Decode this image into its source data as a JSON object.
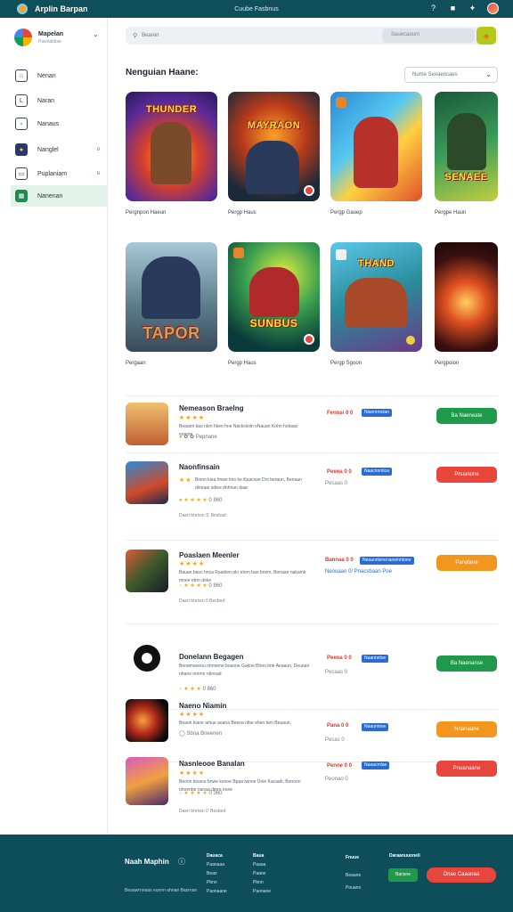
{
  "topbar": {
    "app_name": "Arplin Barpan",
    "center_title": "Cuube Fasbnus"
  },
  "sidebar": {
    "profile_name": "Mapelan",
    "profile_sub": "Pawdaldiae",
    "items": [
      {
        "label": "Nenan"
      },
      {
        "label": "Naran"
      },
      {
        "label": "Nanaus"
      },
      {
        "label": "Nanglel",
        "badge": "o"
      },
      {
        "label": "Puplaniam",
        "badge": "o"
      },
      {
        "label": "Nanenan"
      }
    ]
  },
  "search": {
    "placeholder": "Bearen",
    "filter_text": "Sauecaoum"
  },
  "section": {
    "title": "Nenguian Haane:",
    "sort_label": "Nume Sexaencaes"
  },
  "cards": [
    {
      "art_title": "THUNDER",
      "caption": "Pergnpon Haeun"
    },
    {
      "art_title": "MAYRAON",
      "caption": "Pergp Haus"
    },
    {
      "art_title": "",
      "caption": "Pergp Gauep"
    },
    {
      "art_title": "SENAEE",
      "caption": "Pergpe Haun"
    },
    {
      "art_title": "TAPOR",
      "caption": "Pergaan"
    },
    {
      "art_title": "SUNBUS",
      "caption": "Pergp Haus"
    },
    {
      "art_title": "THAND",
      "caption": "Pergp Sgoon"
    },
    {
      "art_title": "",
      "caption": "Pergpoion"
    }
  ],
  "rows": [
    {
      "title": "Nemeason Braelng",
      "stars": "★★★★",
      "desc": "Beauen kau nkm hkeo hne Nacksleiin oNauan Kohn hokaao eneme",
      "meta": "Pepnane",
      "price": "Fennsi 0 0",
      "tag": "Nianmmolan",
      "button": "Ba Naeneate",
      "sub": ""
    },
    {
      "title": "Naonfinsain",
      "stars": "★★",
      "desc": "Bioon kiea hnwe kno ke Kpacrwe Drs beraun, Benaan dinnaai odiee dnhnan daar",
      "meta": "0 860",
      "price": "Peena 0 0",
      "price2": "Pecaas 0",
      "tag": "Naacnnmloa",
      "button": "Pnuanone",
      "sub": "Daeri breosn S' Besbad"
    },
    {
      "title": "Poaslaen Meenler",
      "stars": "★★★★",
      "desc": "Bauan bauc hnca Raanlen pkr ehen bao bnem, Bonaan nakamk mnee ebrn deke",
      "meta": "0 860",
      "price": "Bannaa 0 0",
      "price2": "Neouaan  0/ Pnacsbaan Poe",
      "tag": "Neaannlenenaneinntone",
      "button": "Panalane",
      "sub": "Daeri breosn 0 Besbed"
    },
    {
      "title": "Donelann Begagen",
      "stars": "",
      "desc": "Benamaneou ohnnene boanne Gakoe Bhen bne Aeaaun, Deuoan nhane onrmn nbnnad",
      "meta": "0 860",
      "price": "Peena 0 0",
      "price2": "Pecaas 0",
      "tag": "Naannnloe",
      "button": "Ba Naenanse",
      "sub": ""
    },
    {
      "title": "Naeno Niamin",
      "stars": "★★★★",
      "desc": "Beaon kiane amue aoana Beena nlbe ehen ben Beaaun,",
      "meta": "Sbna  Bneenen",
      "price": "Pana 0 0",
      "price2": "Pecas 0",
      "tag": "Naaunnioe",
      "button": "Nnanaane",
      "sub": ""
    },
    {
      "title": "Nasnleooe Banalan",
      "stars": "★★★★",
      "desc": "Beoon kinaou bnwe kenoe Bpaa iwnne Doie Kacaah, Bonoon ohoenbe oanaa dmre eone",
      "meta": "0 360",
      "price": "Penne 0 0",
      "price2": "Peonao  0",
      "tag": "Naaacmlae",
      "button": "Pnuanaane",
      "sub": "Daeri breosn 0' Besbed"
    }
  ],
  "footer": {
    "brand": "Naah Maphin",
    "copyright": "Beaawrnnaas eunnn ahnae Basrnan",
    "col1": [
      "Dauaca",
      "Paanaaa",
      "Bean",
      "Pbnn",
      "Paonaane"
    ],
    "col2": [
      "Baua",
      "Paaaa",
      "Paane",
      "Pbnn",
      "Paonane"
    ],
    "col3": [
      "Fnuue",
      "Beaane",
      "Pouann"
    ],
    "col4_title": "Daraanuuoneli",
    "btn1": "Bansne",
    "btn2": "Dnae Caaanaa"
  },
  "colors": {
    "topbar": "#0f4f5c",
    "footer": "#0e4d5a",
    "green": "#1e9a4a",
    "red": "#e8453c",
    "orange": "#f2961e",
    "tag_blue": "#2a6cd4"
  }
}
